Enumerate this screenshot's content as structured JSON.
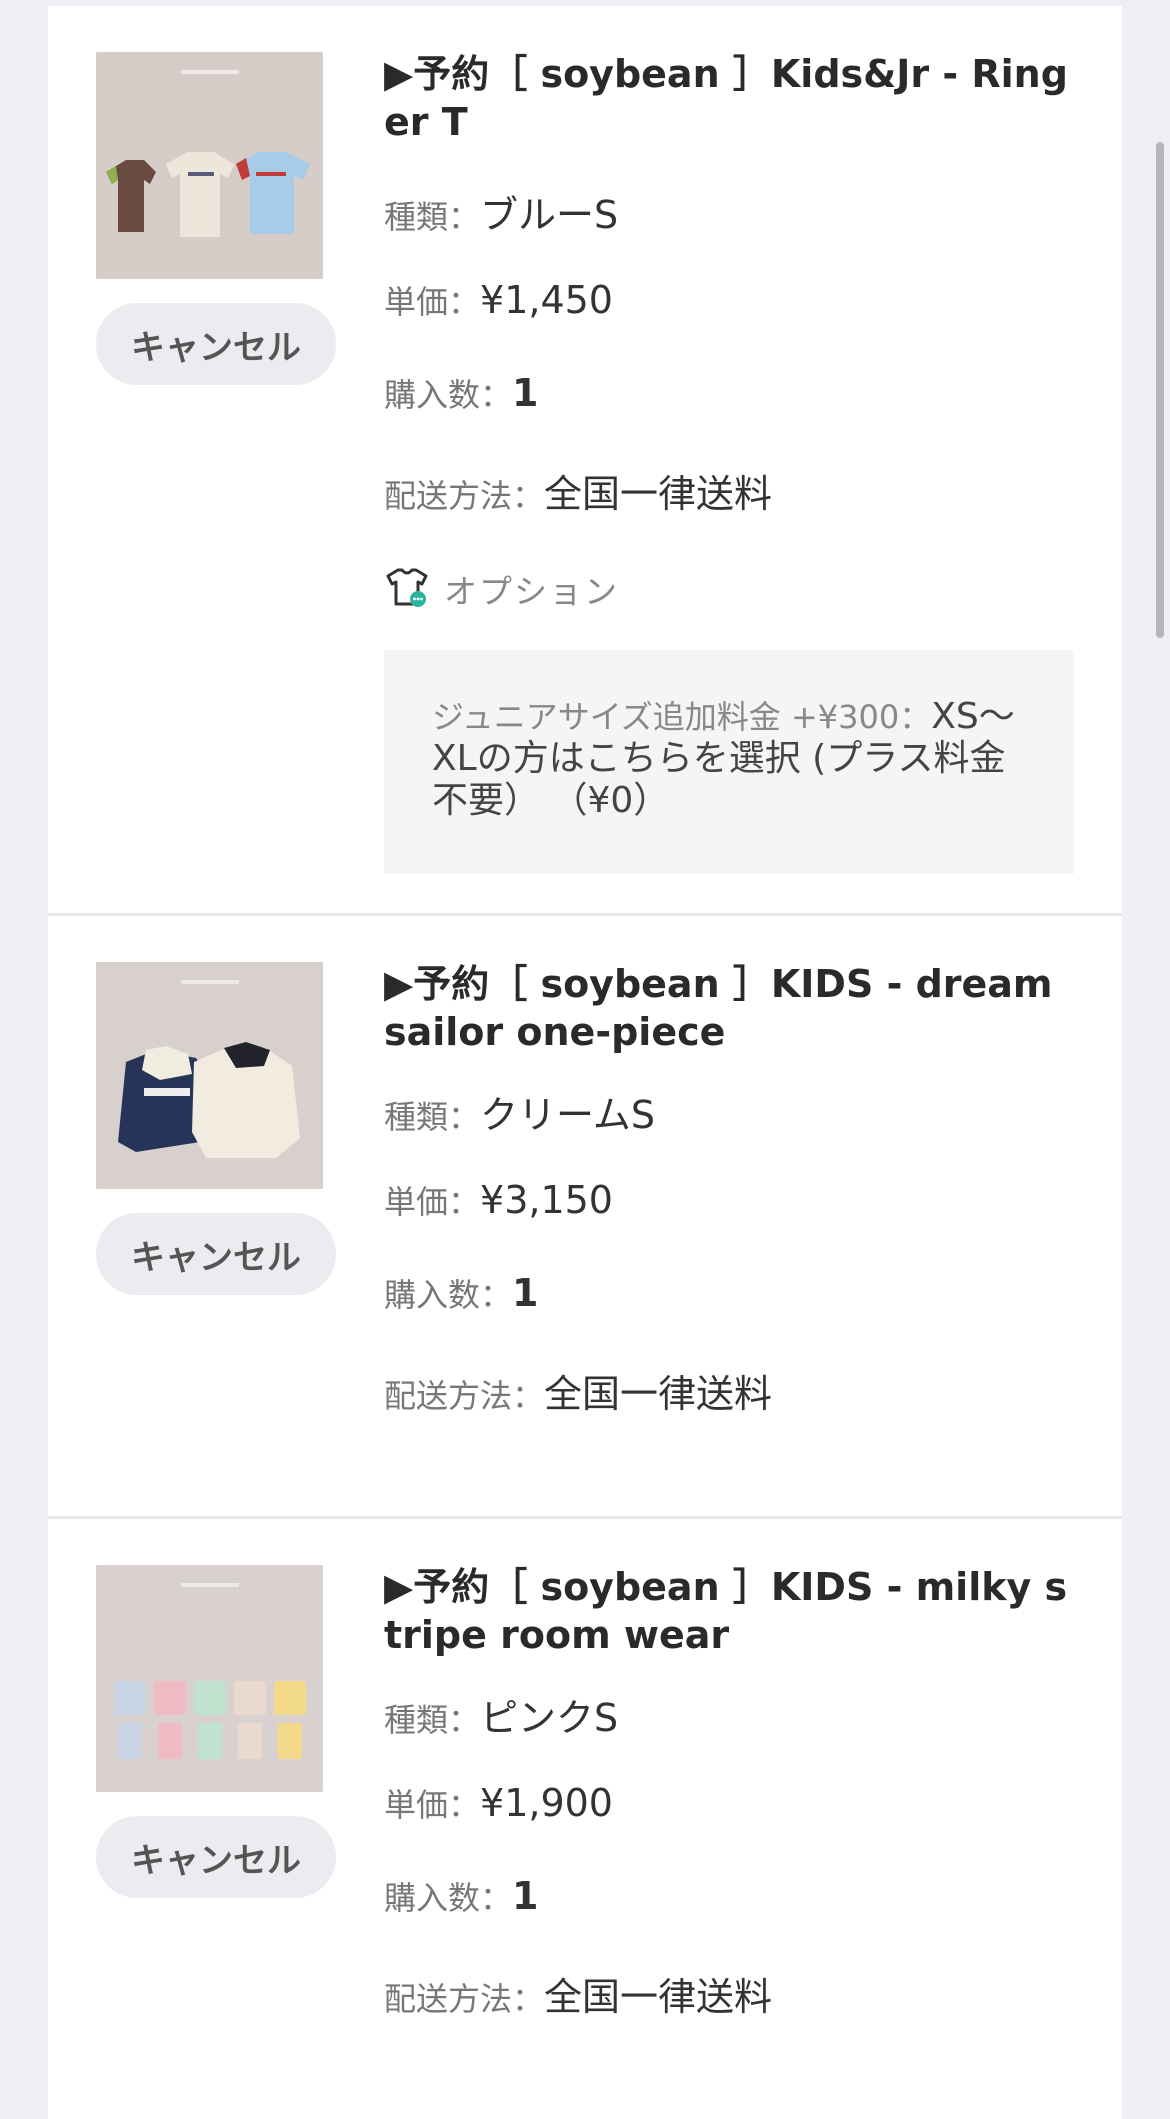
{
  "items": [
    {
      "title": "▶予約［ soybean ］Kids&Jr - Ringer T",
      "cancel_label": "キャンセル",
      "type_label": "種類：",
      "type_value": "ブルーS",
      "price_label": "単価：",
      "price_value": "¥1,450",
      "qty_label": "購入数：",
      "qty_value": "1",
      "shipping_label": "配送方法：",
      "shipping_value": "全国一律送料",
      "option_label": "オプション",
      "option_name": "ジュニアサイズ追加料金 +¥300：",
      "option_value": "XS〜XLの方はこちらを選択 (プラス料金不要） （¥0）",
      "image_alt": "Ringer T product photo"
    },
    {
      "title": "▶予約［ soybean ］KIDS - dream sailor one-piece",
      "cancel_label": "キャンセル",
      "type_label": "種類：",
      "type_value": "クリームS",
      "price_label": "単価：",
      "price_value": "¥3,150",
      "qty_label": "購入数：",
      "qty_value": "1",
      "shipping_label": "配送方法：",
      "shipping_value": "全国一律送料",
      "image_alt": "dream sailor one-piece product photo"
    },
    {
      "title": "▶予約［ soybean ］KIDS - milky stripe room wear",
      "cancel_label": "キャンセル",
      "type_label": "種類：",
      "type_value": "ピンクS",
      "price_label": "単価：",
      "price_value": "¥1,900",
      "qty_label": "購入数：",
      "qty_value": "1",
      "shipping_label": "配送方法：",
      "shipping_value": "全国一律送料",
      "image_alt": "milky stripe room wear product photo"
    }
  ],
  "icons": {
    "option": "tshirt-option-icon"
  },
  "colors": {
    "background": "#eeeff2",
    "card": "#ffffff",
    "cancel_button": "#ebecef",
    "option_box": "#f4f5f7",
    "option_badge": "#2bb3a0"
  }
}
